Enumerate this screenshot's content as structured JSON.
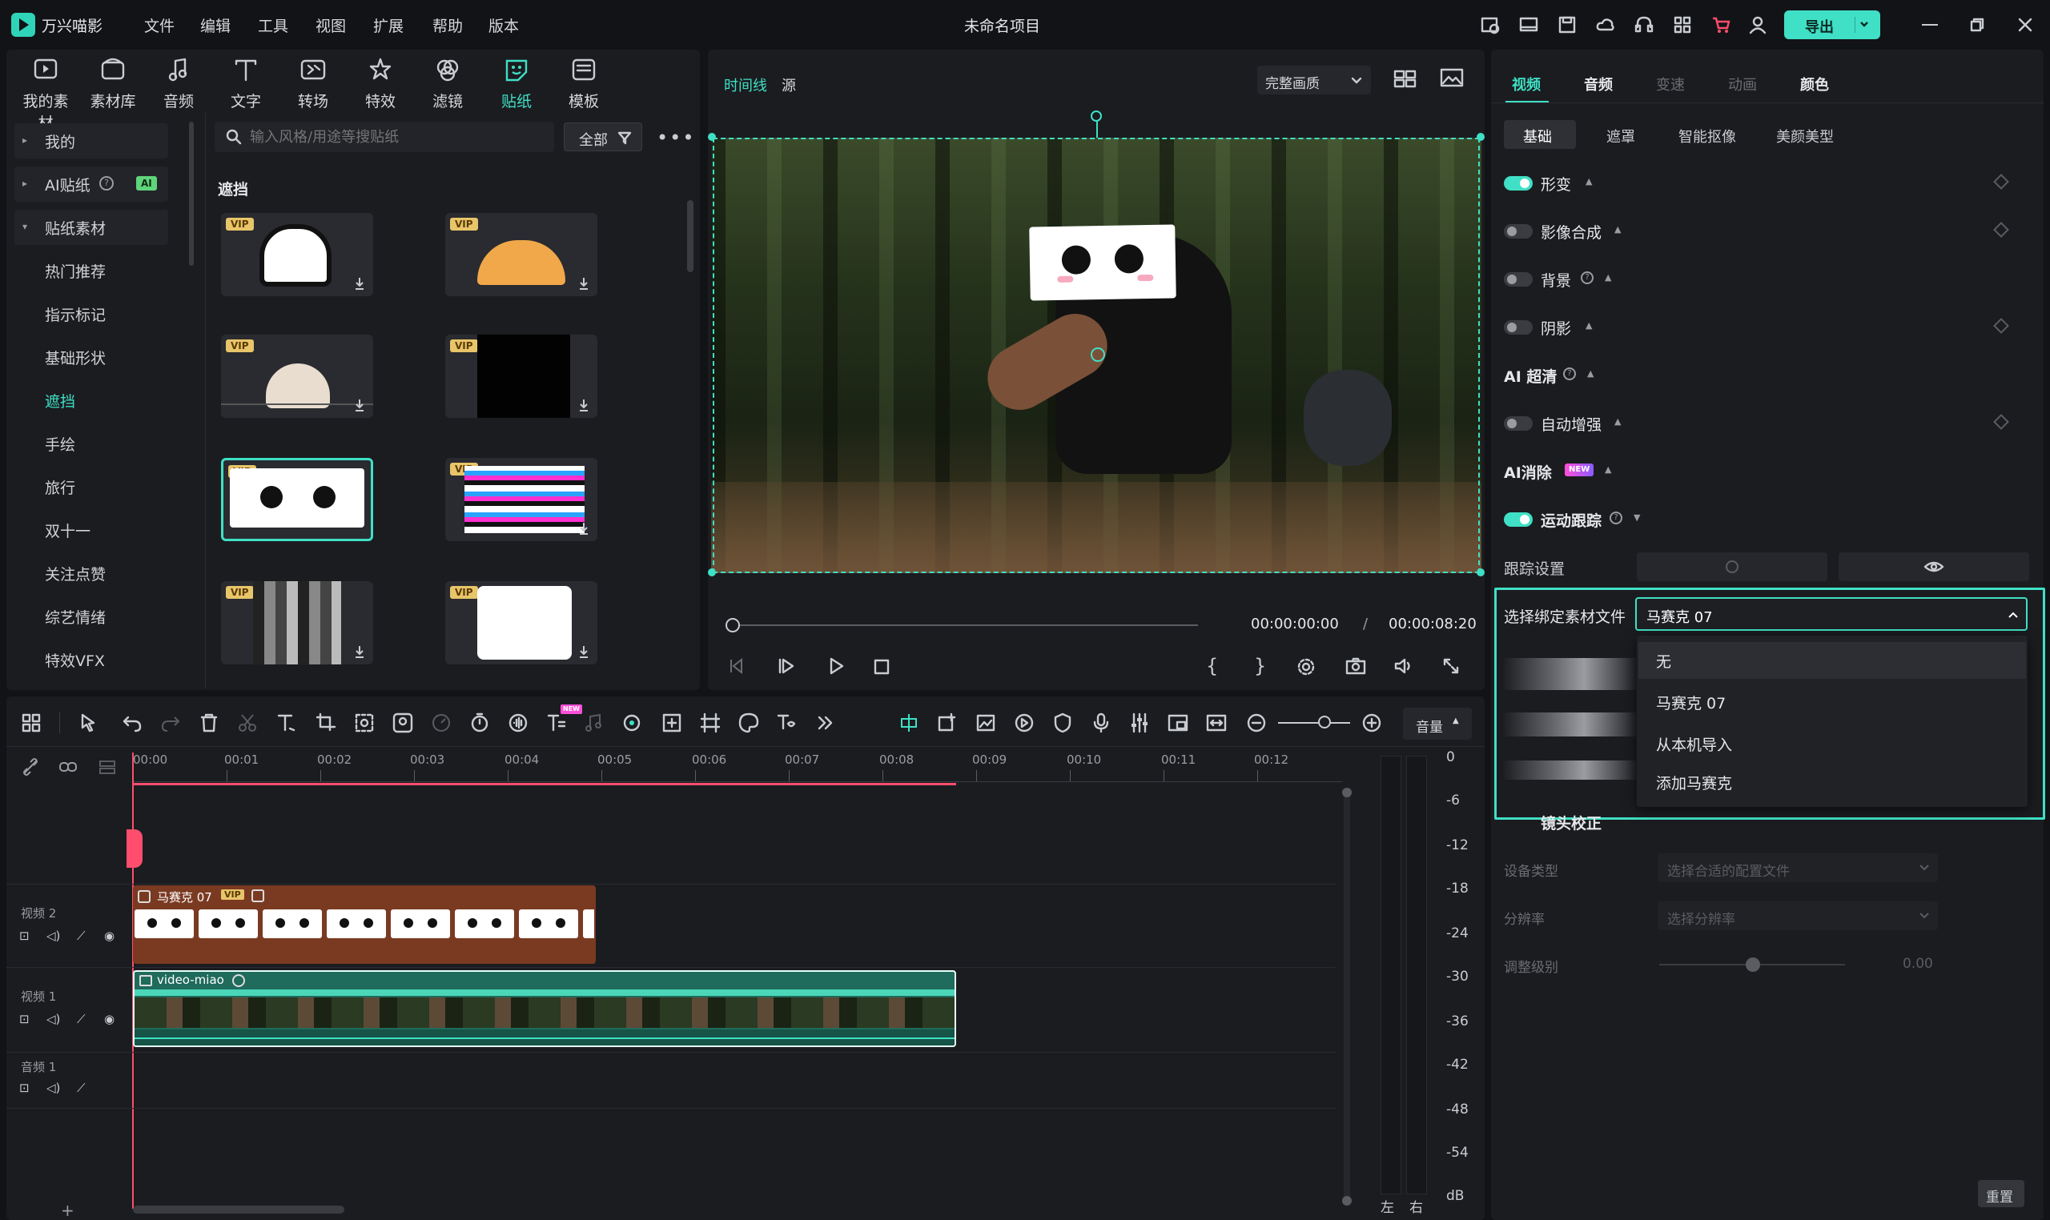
{
  "app": {
    "name": "万兴喵影",
    "title": "未命名项目",
    "export_label": "导出"
  },
  "menu": [
    "文件",
    "编辑",
    "工具",
    "视图",
    "扩展",
    "帮助",
    "版本"
  ],
  "tools": [
    {
      "label": "我的素材",
      "icon": "my-media-icon"
    },
    {
      "label": "素材库",
      "icon": "library-icon"
    },
    {
      "label": "音频",
      "icon": "audio-icon"
    },
    {
      "label": "文字",
      "icon": "text-icon"
    },
    {
      "label": "转场",
      "icon": "transition-icon"
    },
    {
      "label": "特效",
      "icon": "effects-icon"
    },
    {
      "label": "滤镜",
      "icon": "filter-icon"
    },
    {
      "label": "贴纸",
      "icon": "sticker-icon"
    },
    {
      "label": "模板",
      "icon": "template-icon"
    }
  ],
  "sidebar": {
    "items": [
      "我的",
      "AI贴纸",
      "贴纸素材",
      "热门推荐",
      "指示标记",
      "基础形状",
      "遮挡",
      "手绘",
      "旅行",
      "双十一",
      "关注点赞",
      "综艺情绪",
      "特效VFX"
    ],
    "ai_badge": "AI"
  },
  "search": {
    "placeholder": "输入风格/用途等搜贴纸",
    "filter_label": "全部"
  },
  "section_title": "遮挡",
  "vip_label": "VIP",
  "preview": {
    "tab_timeline": "时间线",
    "tab_source": "源",
    "quality": "完整画质",
    "current_time": "00:00:00:00",
    "separator": "/",
    "total_time": "00:00:08:20"
  },
  "right_panel": {
    "tabs": [
      "视频",
      "音频",
      "变速",
      "动画",
      "颜色"
    ],
    "subtabs": [
      "基础",
      "遮罩",
      "智能抠像",
      "美颜美型"
    ],
    "rows": [
      "形变",
      "影像合成",
      "背景",
      "阴影",
      "AI 超清",
      "自动增强",
      "AI消除",
      "运动跟踪",
      "跟踪设置"
    ],
    "new_badge": "NEW",
    "bind_label": "选择绑定素材文件",
    "bind_value": "马赛克 07",
    "dropdown_options": [
      "无",
      "马赛克 07",
      "从本机导入",
      "添加马赛克"
    ],
    "lens_correction": "镜头校正",
    "device_type_label": "设备类型",
    "device_type_placeholder": "选择合适的配置文件",
    "resolution_label": "分辨率",
    "resolution_placeholder": "选择分辨率",
    "adjust_label": "调整级别",
    "adjust_value": "0.00",
    "reset_label": "重置"
  },
  "timeline": {
    "ticks": [
      "00:00",
      "00:01",
      "00:02",
      "00:03",
      "00:04",
      "00:05",
      "00:06",
      "00:07",
      "00:08",
      "00:09",
      "00:10",
      "00:11",
      "00:12"
    ],
    "volume_label": "音量",
    "tracks": [
      "视频 2",
      "视频 1",
      "音频 1"
    ],
    "sticker_clip": "马赛克 07",
    "video_clip": "video-miao",
    "meter_ticks": [
      "0",
      "-6",
      "-12",
      "-18",
      "-24",
      "-30",
      "-36",
      "-42",
      "-48",
      "-54"
    ],
    "meter_db": "dB",
    "left_ch": "左",
    "right_ch": "右",
    "new_badge": "NEW"
  }
}
